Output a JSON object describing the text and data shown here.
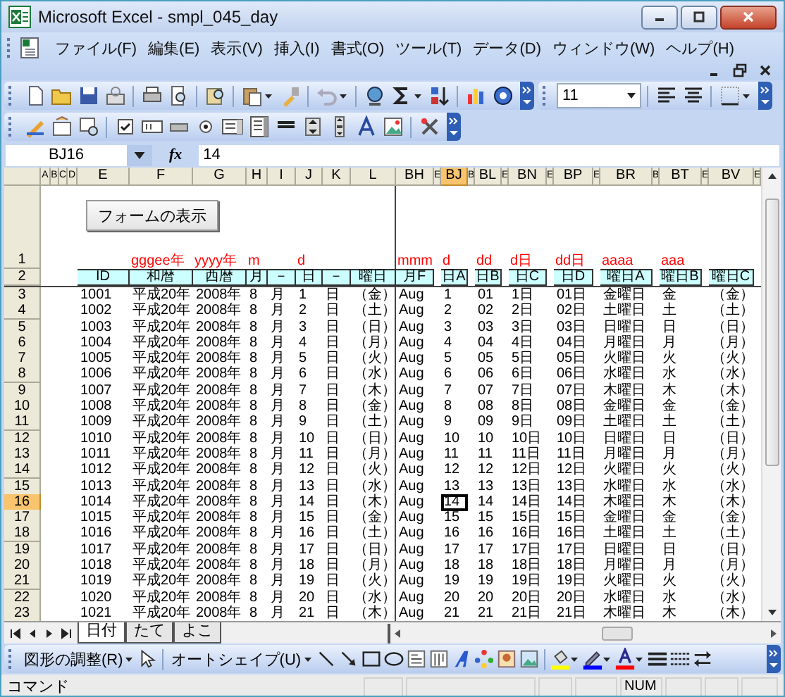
{
  "window": {
    "title": "Microsoft Excel - smpl_045_day"
  },
  "menu": [
    "ファイル(F)",
    "編集(E)",
    "表示(V)",
    "挿入(I)",
    "書式(O)",
    "ツール(T)",
    "データ(D)",
    "ウィンドウ(W)",
    "ヘルプ(H)"
  ],
  "formatting_toolbar": {
    "font_size": "11"
  },
  "formula_bar": {
    "name_box": "BJ16",
    "function_label": "fx",
    "value": "14"
  },
  "sheet": {
    "columns": [
      {
        "header": "A",
        "selected": false
      },
      {
        "header": "B",
        "selected": false
      },
      {
        "header": "C",
        "selected": false
      },
      {
        "header": "D",
        "selected": false
      },
      {
        "header": "E",
        "selected": false,
        "title": "ID"
      },
      {
        "header": "F",
        "selected": false,
        "format": "gggee年",
        "title": "和暦"
      },
      {
        "header": "G",
        "selected": false,
        "format": "yyyy年",
        "title": "西暦"
      },
      {
        "header": "H",
        "selected": false,
        "format": "m",
        "title": "月"
      },
      {
        "header": "I",
        "selected": false,
        "title": "－"
      },
      {
        "header": "J",
        "selected": false,
        "format": "d",
        "title": "日"
      },
      {
        "header": "K",
        "selected": false,
        "title": "－"
      },
      {
        "header": "L",
        "selected": false,
        "title": "曜日"
      },
      {
        "header": "BH",
        "selected": false,
        "format": "mmm",
        "title": "月F"
      },
      {
        "header": "E",
        "selected": false
      },
      {
        "header": "BJ",
        "selected": true,
        "format": "d",
        "title": "日A"
      },
      {
        "header": "B",
        "selected": false
      },
      {
        "header": "BL",
        "selected": false,
        "format": "dd",
        "title": "日B"
      },
      {
        "header": "E",
        "selected": false
      },
      {
        "header": "BN",
        "selected": false,
        "format": "d日",
        "title": "日C"
      },
      {
        "header": "E",
        "selected": false
      },
      {
        "header": "BP",
        "selected": false,
        "format": "dd日",
        "title": "日D"
      },
      {
        "header": "E",
        "selected": false
      },
      {
        "header": "BR",
        "selected": false,
        "format": "aaaa",
        "title": "曜日A"
      },
      {
        "header": "B",
        "selected": false
      },
      {
        "header": "BT",
        "selected": false,
        "format": "aaa",
        "title": "曜日B"
      },
      {
        "header": "E",
        "selected": false
      },
      {
        "header": "BV",
        "selected": false,
        "title": "曜日C"
      },
      {
        "header": "E",
        "selected": false
      }
    ],
    "button": "フォームの表示",
    "format_row": "1",
    "title_row": "2",
    "rows": [
      {
        "num": "3",
        "selected": false,
        "cells": [
          "",
          "",
          "",
          "",
          "1001",
          "平成20年",
          "2008年",
          "8",
          "月",
          "1",
          "日",
          "（金）",
          "Aug",
          "",
          "1",
          "",
          "01",
          "",
          "1日",
          "",
          "01日",
          "",
          "金曜日",
          "",
          "金",
          "",
          "（金）",
          ""
        ]
      },
      {
        "num": "4",
        "selected": false,
        "cells": [
          "",
          "",
          "",
          "",
          "1002",
          "平成20年",
          "2008年",
          "8",
          "月",
          "2",
          "日",
          "（土）",
          "Aug",
          "",
          "2",
          "",
          "02",
          "",
          "2日",
          "",
          "02日",
          "",
          "土曜日",
          "",
          "土",
          "",
          "（土）",
          ""
        ]
      },
      {
        "num": "5",
        "selected": false,
        "cells": [
          "",
          "",
          "",
          "",
          "1003",
          "平成20年",
          "2008年",
          "8",
          "月",
          "3",
          "日",
          "（日）",
          "Aug",
          "",
          "3",
          "",
          "03",
          "",
          "3日",
          "",
          "03日",
          "",
          "日曜日",
          "",
          "日",
          "",
          "（日）",
          ""
        ]
      },
      {
        "num": "6",
        "selected": false,
        "cells": [
          "",
          "",
          "",
          "",
          "1004",
          "平成20年",
          "2008年",
          "8",
          "月",
          "4",
          "日",
          "（月）",
          "Aug",
          "",
          "4",
          "",
          "04",
          "",
          "4日",
          "",
          "04日",
          "",
          "月曜日",
          "",
          "月",
          "",
          "（月）",
          ""
        ]
      },
      {
        "num": "7",
        "selected": false,
        "cells": [
          "",
          "",
          "",
          "",
          "1005",
          "平成20年",
          "2008年",
          "8",
          "月",
          "5",
          "日",
          "（火）",
          "Aug",
          "",
          "5",
          "",
          "05",
          "",
          "5日",
          "",
          "05日",
          "",
          "火曜日",
          "",
          "火",
          "",
          "（火）",
          ""
        ]
      },
      {
        "num": "8",
        "selected": false,
        "cells": [
          "",
          "",
          "",
          "",
          "1006",
          "平成20年",
          "2008年",
          "8",
          "月",
          "6",
          "日",
          "（水）",
          "Aug",
          "",
          "6",
          "",
          "06",
          "",
          "6日",
          "",
          "06日",
          "",
          "水曜日",
          "",
          "水",
          "",
          "（水）",
          ""
        ]
      },
      {
        "num": "9",
        "selected": false,
        "cells": [
          "",
          "",
          "",
          "",
          "1007",
          "平成20年",
          "2008年",
          "8",
          "月",
          "7",
          "日",
          "（木）",
          "Aug",
          "",
          "7",
          "",
          "07",
          "",
          "7日",
          "",
          "07日",
          "",
          "木曜日",
          "",
          "木",
          "",
          "（木）",
          ""
        ]
      },
      {
        "num": "10",
        "selected": false,
        "cells": [
          "",
          "",
          "",
          "",
          "1008",
          "平成20年",
          "2008年",
          "8",
          "月",
          "8",
          "日",
          "（金）",
          "Aug",
          "",
          "8",
          "",
          "08",
          "",
          "8日",
          "",
          "08日",
          "",
          "金曜日",
          "",
          "金",
          "",
          "（金）",
          ""
        ]
      },
      {
        "num": "11",
        "selected": false,
        "cells": [
          "",
          "",
          "",
          "",
          "1009",
          "平成20年",
          "2008年",
          "8",
          "月",
          "9",
          "日",
          "（土）",
          "Aug",
          "",
          "9",
          "",
          "09",
          "",
          "9日",
          "",
          "09日",
          "",
          "土曜日",
          "",
          "土",
          "",
          "（土）",
          ""
        ]
      },
      {
        "num": "12",
        "selected": false,
        "cells": [
          "",
          "",
          "",
          "",
          "1010",
          "平成20年",
          "2008年",
          "8",
          "月",
          "10",
          "日",
          "（日）",
          "Aug",
          "",
          "10",
          "",
          "10",
          "",
          "10日",
          "",
          "10日",
          "",
          "日曜日",
          "",
          "日",
          "",
          "（日）",
          ""
        ]
      },
      {
        "num": "13",
        "selected": false,
        "cells": [
          "",
          "",
          "",
          "",
          "1011",
          "平成20年",
          "2008年",
          "8",
          "月",
          "11",
          "日",
          "（月）",
          "Aug",
          "",
          "11",
          "",
          "11",
          "",
          "11日",
          "",
          "11日",
          "",
          "月曜日",
          "",
          "月",
          "",
          "（月）",
          ""
        ]
      },
      {
        "num": "14",
        "selected": false,
        "cells": [
          "",
          "",
          "",
          "",
          "1012",
          "平成20年",
          "2008年",
          "8",
          "月",
          "12",
          "日",
          "（火）",
          "Aug",
          "",
          "12",
          "",
          "12",
          "",
          "12日",
          "",
          "12日",
          "",
          "火曜日",
          "",
          "火",
          "",
          "（火）",
          ""
        ]
      },
      {
        "num": "15",
        "selected": false,
        "cells": [
          "",
          "",
          "",
          "",
          "1013",
          "平成20年",
          "2008年",
          "8",
          "月",
          "13",
          "日",
          "（水）",
          "Aug",
          "",
          "13",
          "",
          "13",
          "",
          "13日",
          "",
          "13日",
          "",
          "水曜日",
          "",
          "水",
          "",
          "（水）",
          ""
        ]
      },
      {
        "num": "16",
        "selected": true,
        "cells": [
          "",
          "",
          "",
          "",
          "1014",
          "平成20年",
          "2008年",
          "8",
          "月",
          "14",
          "日",
          "（木）",
          "Aug",
          "",
          "14",
          "",
          "14",
          "",
          "14日",
          "",
          "14日",
          "",
          "木曜日",
          "",
          "木",
          "",
          "（木）",
          ""
        ]
      },
      {
        "num": "17",
        "selected": false,
        "cells": [
          "",
          "",
          "",
          "",
          "1015",
          "平成20年",
          "2008年",
          "8",
          "月",
          "15",
          "日",
          "（金）",
          "Aug",
          "",
          "15",
          "",
          "15",
          "",
          "15日",
          "",
          "15日",
          "",
          "金曜日",
          "",
          "金",
          "",
          "（金）",
          ""
        ]
      },
      {
        "num": "18",
        "selected": false,
        "cells": [
          "",
          "",
          "",
          "",
          "1016",
          "平成20年",
          "2008年",
          "8",
          "月",
          "16",
          "日",
          "（土）",
          "Aug",
          "",
          "16",
          "",
          "16",
          "",
          "16日",
          "",
          "16日",
          "",
          "土曜日",
          "",
          "土",
          "",
          "（土）",
          ""
        ]
      },
      {
        "num": "19",
        "selected": false,
        "cells": [
          "",
          "",
          "",
          "",
          "1017",
          "平成20年",
          "2008年",
          "8",
          "月",
          "17",
          "日",
          "（日）",
          "Aug",
          "",
          "17",
          "",
          "17",
          "",
          "17日",
          "",
          "17日",
          "",
          "日曜日",
          "",
          "日",
          "",
          "（日）",
          ""
        ]
      },
      {
        "num": "20",
        "selected": false,
        "cells": [
          "",
          "",
          "",
          "",
          "1018",
          "平成20年",
          "2008年",
          "8",
          "月",
          "18",
          "日",
          "（月）",
          "Aug",
          "",
          "18",
          "",
          "18",
          "",
          "18日",
          "",
          "18日",
          "",
          "月曜日",
          "",
          "月",
          "",
          "（月）",
          ""
        ]
      },
      {
        "num": "21",
        "selected": false,
        "cells": [
          "",
          "",
          "",
          "",
          "1019",
          "平成20年",
          "2008年",
          "8",
          "月",
          "19",
          "日",
          "（火）",
          "Aug",
          "",
          "19",
          "",
          "19",
          "",
          "19日",
          "",
          "19日",
          "",
          "火曜日",
          "",
          "火",
          "",
          "（火）",
          ""
        ]
      },
      {
        "num": "22",
        "selected": false,
        "cells": [
          "",
          "",
          "",
          "",
          "1020",
          "平成20年",
          "2008年",
          "8",
          "月",
          "20",
          "日",
          "（水）",
          "Aug",
          "",
          "20",
          "",
          "20",
          "",
          "20日",
          "",
          "20日",
          "",
          "水曜日",
          "",
          "水",
          "",
          "（水）",
          ""
        ]
      },
      {
        "num": "23",
        "selected": false,
        "cells": [
          "",
          "",
          "",
          "",
          "1021",
          "平成20年",
          "2008年",
          "8",
          "月",
          "21",
          "日",
          "（木）",
          "Aug",
          "",
          "21",
          "",
          "21",
          "",
          "21日",
          "",
          "21日",
          "",
          "木曜日",
          "",
          "木",
          "",
          "（木）",
          ""
        ]
      }
    ]
  },
  "sheet_tabs": [
    {
      "label": "日付",
      "selected": true
    },
    {
      "label": "たて",
      "selected": false
    },
    {
      "label": "よこ",
      "selected": false
    }
  ],
  "drawing_toolbar": {
    "menus": [
      "図形の調整(R)",
      "オートシェイプ(U)"
    ]
  },
  "status_bar": {
    "mode": "コマンド",
    "indicator": "NUM"
  }
}
